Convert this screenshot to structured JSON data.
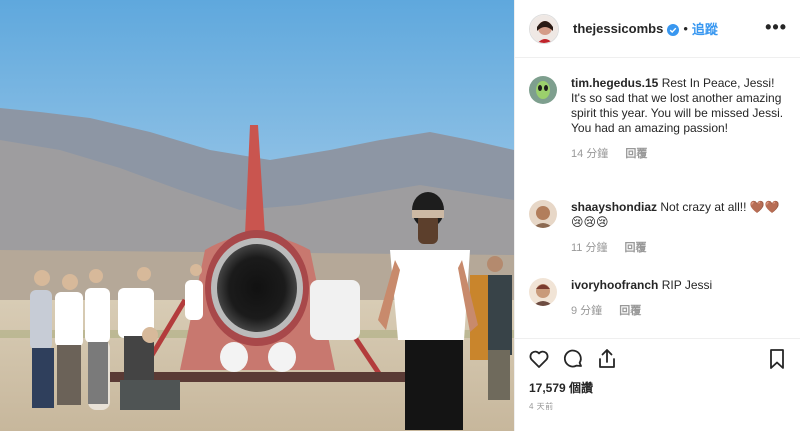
{
  "post": {
    "username": "thejessicombs",
    "separator": "•",
    "follow_label": "追蹤",
    "more_label": "•••"
  },
  "comments": [
    {
      "username": "tim.hegedus.15",
      "text": "Rest In Peace, Jessi! It's so sad that we lost another amazing spirit this year. You will be missed Jessi. You had an amazing passion!",
      "age": "14 分鐘",
      "reply_label": "回覆"
    },
    {
      "username": "shaayshondiaz",
      "text": "Not crazy at all!! 🤎🤎 😢😢😢",
      "age": "11 分鐘",
      "reply_label": "回覆"
    },
    {
      "username": "ivoryhoofranch",
      "text": "RIP Jessi",
      "age": "9 分鐘",
      "reply_label": "回覆"
    }
  ],
  "footer": {
    "views": "17,579 個讚",
    "posted": "4 天前"
  },
  "icons": [
    "heart-icon",
    "comment-icon",
    "share-icon",
    "bookmark-icon",
    "verified-badge-icon",
    "more-options-icon"
  ],
  "colors": {
    "link": "#3897f0",
    "text": "#262626",
    "muted": "#999999",
    "verified": "#3897f0"
  }
}
